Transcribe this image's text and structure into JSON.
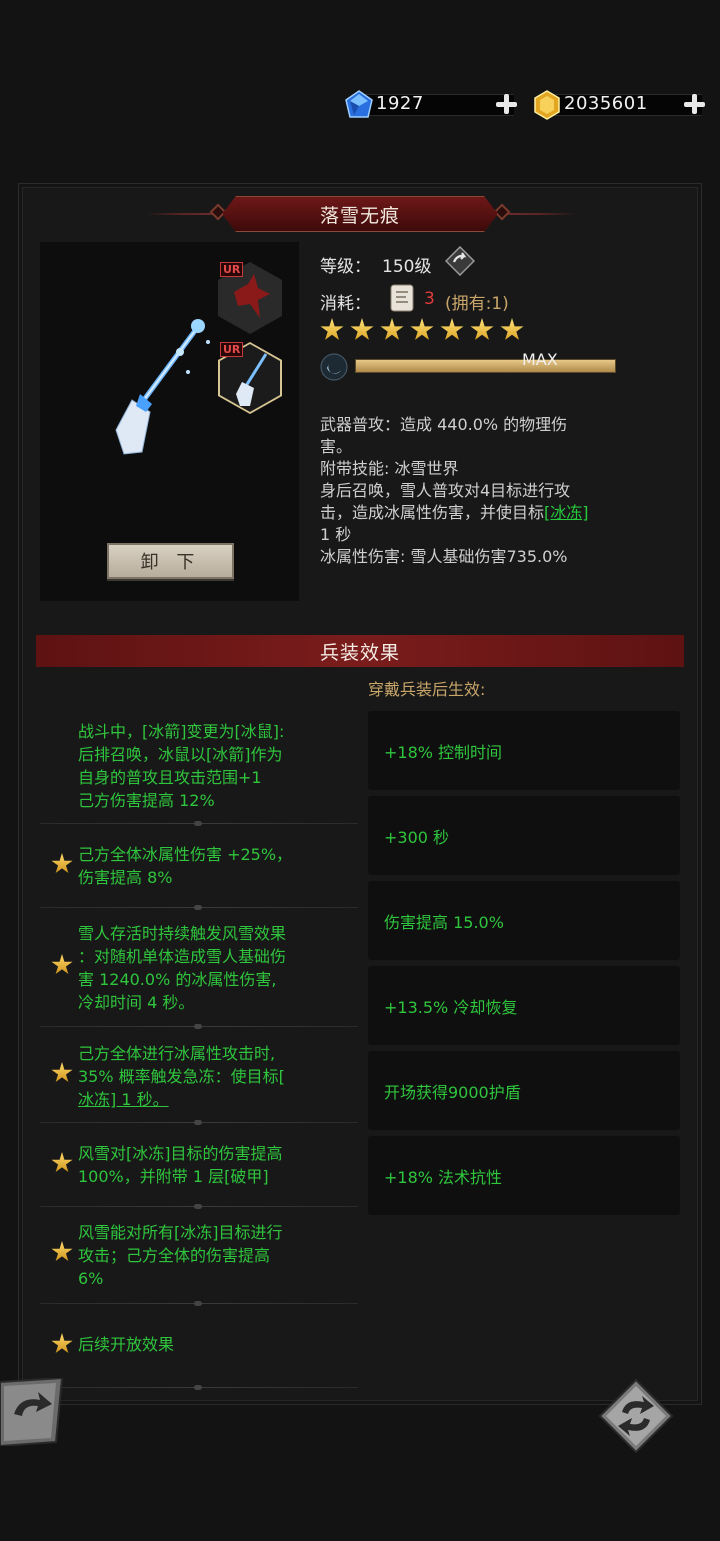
{
  "currency": {
    "gems": "1927",
    "gold": "2035601"
  },
  "weapon": {
    "name": "落雪无痕",
    "rarity_tag": "UR",
    "unload_label": "卸 下",
    "level_label": "等级：",
    "level_value": "150级",
    "cost_label": "消耗：",
    "cost_value": "3",
    "cost_owned": "(拥有:1)",
    "stars": 7,
    "progress_label": "MAX",
    "progress": 1.0,
    "description": [
      "武器普攻：造成 440.0% 的物理伤",
      "害。",
      "附带技能: 冰雪世界",
      "身后召唤，雪人普攻对4目标进行攻",
      "击，造成冰属性伤害，并使目标",
      "[冰冻]",
      "1 秒",
      "冰属性伤害: 雪人基础伤害735.0%"
    ]
  },
  "effects": {
    "header": "兵装效果",
    "subheader": "穿戴兵装后生效:",
    "items": [
      {
        "text": "战斗中，[冰箭]变更为[冰鼠]:后排召唤，冰鼠以[冰箭]作为自身的普攻且攻击范围+1己方伤害提高 12%",
        "lines": [
          "战斗中，[冰箭]变更为[冰鼠]:",
          "后排召唤，冰鼠以[冰箭]作为",
          "自身的普攻且攻击范围+1",
          "己方伤害提高 12%"
        ],
        "star": false
      },
      {
        "lines": [
          "己方全体冰属性伤害 +25%，",
          "伤害提高 8%"
        ],
        "star": true
      },
      {
        "lines": [
          "雪人存活时持续触发风雪效果",
          "：对随机单体造成雪人基础伤",
          "害 1240.0% 的冰属性伤害,",
          "冷却时间 4 秒。"
        ],
        "star": true
      },
      {
        "lines": [
          "己方全体进行冰属性攻击时,",
          "35% 概率触发急冻：使目标[",
          "冰冻] 1 秒。"
        ],
        "star": true
      },
      {
        "lines": [
          "风雪对[冰冻]目标的伤害提高",
          "100%，并附带 1 层[破甲]"
        ],
        "star": true
      },
      {
        "lines": [
          "风雪能对所有[冰冻]目标进行",
          "攻击；己方全体的伤害提高",
          "6%"
        ],
        "star": true
      },
      {
        "lines": [
          "后续开放效果"
        ],
        "star": true
      }
    ],
    "bonuses": [
      "+18% 控制时间",
      "+300 秒",
      "伤害提高 15.0%",
      "+13.5% 冷却恢复",
      "开场获得9000护盾",
      "+18% 法术抗性"
    ]
  },
  "icons": {
    "gem": "blue-gem-icon",
    "gold": "gold-coin-icon",
    "plus": "plus-icon",
    "upgrade": "upgrade-arrow-icon",
    "scroll": "scroll-item-icon",
    "swap": "swap-icon",
    "back": "back-arrow-icon"
  },
  "colors": {
    "effect_green": "#2fc53d",
    "banner_red": "#6e1818",
    "gold_text": "#c8a66a",
    "cost_red": "#e23a3a"
  }
}
